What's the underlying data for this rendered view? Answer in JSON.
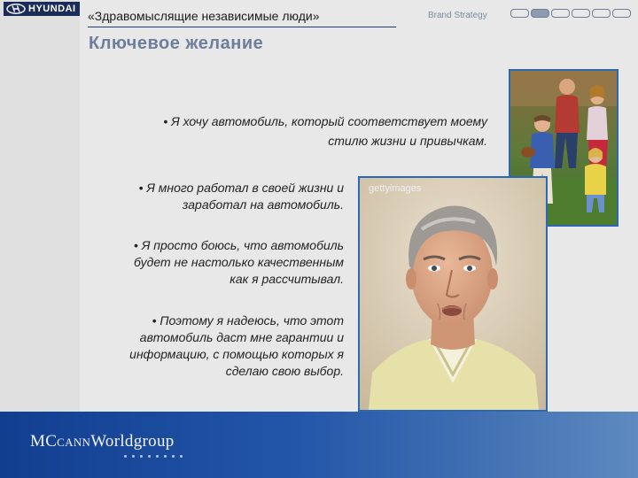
{
  "header": {
    "logo_text": "HYUNDAI",
    "topic": "«Здравомыслящие независимые люди»",
    "brand_label": "Brand Strategy",
    "progress_steps": 6,
    "progress_active_index": 1
  },
  "slide": {
    "title": "Ключевое желание",
    "bullet_main": "Я хочу автомобиль, который соответствует моему стилю жизни и привычкам.",
    "bullets": [
      "Я много работал в своей жизни и заработал на автомобиль.",
      "Я просто боюсь, что автомобиль будет не настолько качественным как я рассчитывал.",
      "Поэтому я надеюсь, что этот автомобиль даст мне гарантии и информацию, с помощью которых я сделаю свою выбор."
    ],
    "watermark": "gettyimages"
  },
  "footer": {
    "brand_mc": "MC",
    "brand_cann": "CANN",
    "brand_world": "Worldgroup"
  },
  "colors": {
    "accent": "#1f3a78",
    "heading": "#6d7e9c",
    "photo_border": "#2c68b5",
    "footer": "#1d4d9e"
  }
}
